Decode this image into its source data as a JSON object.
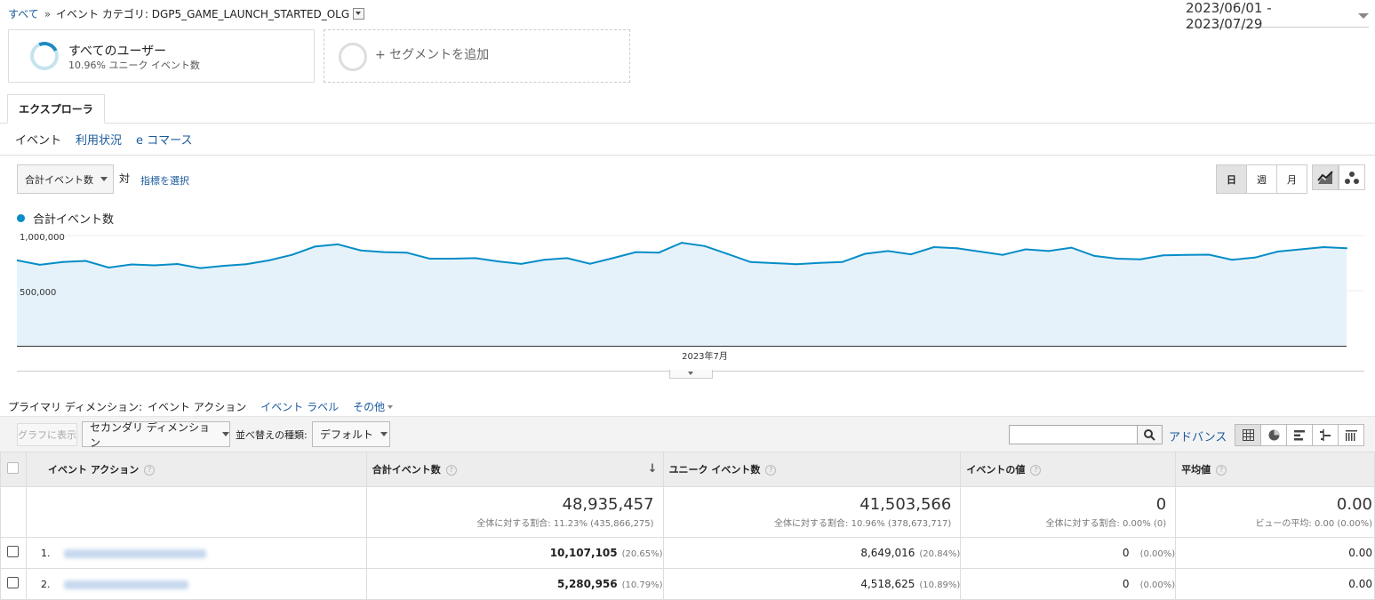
{
  "breadcrumb": {
    "all": "すべて",
    "sep": "»",
    "category": "イベント カテゴリ: DGP5_GAME_LAUNCH_STARTED_OLG"
  },
  "date_range": "2023/06/01 - 2023/07/29",
  "segments": {
    "all_users": {
      "title": "すべてのユーザー",
      "sub": "10.96% ユニーク イベント数"
    },
    "add": "+ セグメントを追加"
  },
  "tabs": {
    "explorer": "エクスプローラ"
  },
  "subtabs": [
    "イベント",
    "利用状況",
    "e コマース"
  ],
  "metric_select": {
    "value": "合計イベント数",
    "vs": "対",
    "pick": "指標を選択"
  },
  "granularity": [
    "日",
    "週",
    "月"
  ],
  "legend": {
    "series": "合計イベント数"
  },
  "chart_data": {
    "type": "area",
    "series": [
      {
        "name": "合計イベント数",
        "values": [
          775000,
          735000,
          760000,
          770000,
          710000,
          738000,
          730000,
          742000,
          705000,
          725000,
          740000,
          775000,
          825000,
          900000,
          920000,
          865000,
          850000,
          845000,
          790000,
          790000,
          795000,
          765000,
          743000,
          780000,
          795000,
          744000,
          795000,
          850000,
          845000,
          935000,
          905000,
          833000,
          760000,
          750000,
          740000,
          752000,
          760000,
          835000,
          860000,
          830000,
          895000,
          885000,
          855000,
          825000,
          875000,
          860000,
          890000,
          815000,
          790000,
          785000,
          820000,
          825000,
          827000,
          781000,
          800000,
          855000,
          875000,
          895000,
          885000
        ]
      }
    ],
    "x_start": "2023/06/01",
    "x_end": "2023/07/29",
    "ylim": [
      0,
      1000000
    ],
    "y_ticks": [
      "1,000,000",
      "500,000"
    ],
    "x_tick_label": "2023年7月",
    "colors": {
      "line": "#058dc7",
      "fill": "#e6f2fa"
    },
    "grid": true
  },
  "dimensions": {
    "label": "プライマリ ディメンション:",
    "active": "イベント アクション",
    "other": "イベント ラベル",
    "more": "その他"
  },
  "toolbar": {
    "plot": "グラフに表示",
    "secondary": "セカンダリ ディメンション",
    "sort_label": "並べ替えの種類:",
    "sort_value": "デフォルト",
    "advanced": "アドバンス",
    "search_placeholder": ""
  },
  "table": {
    "headers": [
      "イベント アクション",
      "合計イベント数",
      "ユニーク イベント数",
      "イベントの値",
      "平均値"
    ],
    "totals": [
      {
        "value": "48,935,457",
        "sub": "全体に対する割合: 11.23% (435,866,275)"
      },
      {
        "value": "41,503,566",
        "sub": "全体に対する割合: 10.96% (378,673,717)"
      },
      {
        "value": "0",
        "sub": "全体に対する割合: 0.00% (0)"
      },
      {
        "value": "0.00",
        "sub": "ビューの平均: 0.00 (0.00%)"
      }
    ],
    "rows": [
      {
        "num": "1.",
        "total": "10,107,105",
        "total_pct": "(20.65%)",
        "unique": "8,649,016",
        "unique_pct": "(20.84%)",
        "value": "0",
        "value_pct": "(0.00%)",
        "avg": "0.00"
      },
      {
        "num": "2.",
        "total": "5,280,956",
        "total_pct": "(10.79%)",
        "unique": "4,518,625",
        "unique_pct": "(10.89%)",
        "value": "0",
        "value_pct": "(0.00%)",
        "avg": "0.00"
      }
    ]
  }
}
